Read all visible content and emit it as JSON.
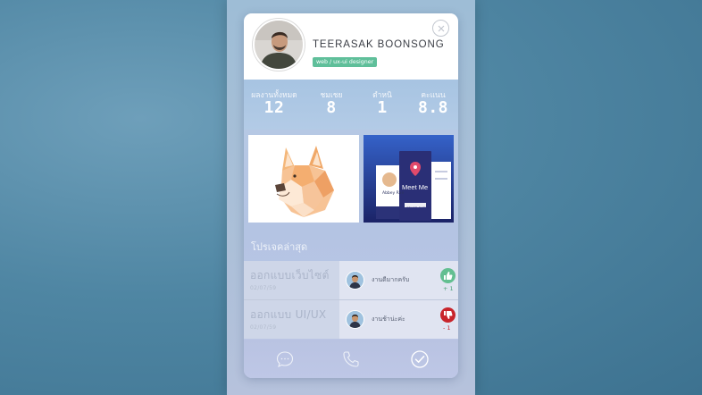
{
  "profile": {
    "name": "TEERASAK BOONSONG",
    "role": "web / ux-ui designer"
  },
  "stats": [
    {
      "label": "ผลงานทั้งหมด",
      "value": "12"
    },
    {
      "label": "ชมเชย",
      "value": "8"
    },
    {
      "label": "ตำหนิ",
      "value": "1"
    },
    {
      "label": "คะแนน",
      "value": "8.8"
    }
  ],
  "portfolio": {
    "thumb2": {
      "title": "Meet Me",
      "cta": "START RATING",
      "profile_name": "Abbey Rae"
    }
  },
  "section_title": "โปรเจคล่าสุด",
  "projects": [
    {
      "title": "ออกแบบเว็บไซต์",
      "date": "02/07/59",
      "comment": "งานดีมากครับ",
      "vote": "up",
      "count": "+ 1"
    },
    {
      "title": "ออกแบบ UI/UX",
      "date": "02/07/59",
      "comment": "งานช้าน่ะค่ะ",
      "vote": "down",
      "count": "- 1"
    }
  ],
  "colors": {
    "accent_green": "#5fbf9a",
    "thumbs_up": "#63bf91",
    "thumbs_down": "#c8242b"
  },
  "icons": [
    "close-icon",
    "thumbs-up-icon",
    "thumbs-down-icon",
    "chat-bubble-icon",
    "phone-icon",
    "check-circle-icon"
  ]
}
